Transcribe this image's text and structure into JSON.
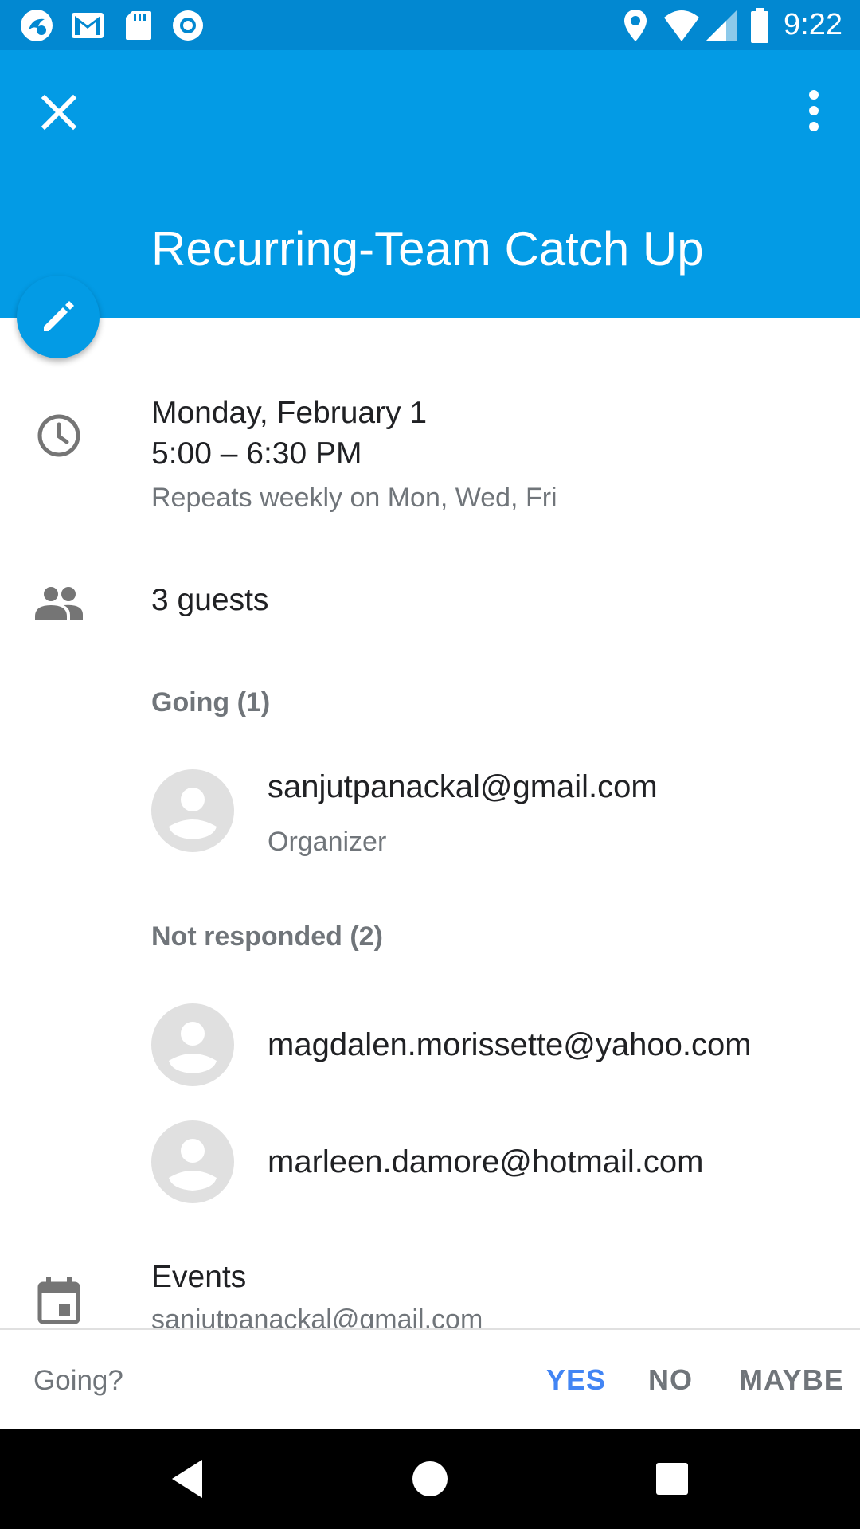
{
  "status_bar": {
    "time": "9:22",
    "left_icons": [
      "app-notification-icon",
      "gmail-icon",
      "sd-card-icon",
      "record-icon"
    ],
    "right_icons": [
      "location-icon",
      "wifi-icon",
      "cell-signal-icon",
      "battery-icon"
    ]
  },
  "app_bar": {
    "close_icon": "close-icon",
    "more_icon": "more-vert-icon",
    "title": "Recurring-Team Catch Up",
    "color": "#039be5"
  },
  "fab": {
    "icon": "edit-pencil-icon"
  },
  "event": {
    "date": "Monday, February 1",
    "time_range": "5:00 – 6:30 PM",
    "recurrence": "Repeats weekly on Mon, Wed, Fri"
  },
  "guests": {
    "summary": "3 guests",
    "groups": [
      {
        "header": "Going (1)",
        "people": [
          {
            "email": "sanjutpanackal@gmail.com",
            "role": "Organizer"
          }
        ]
      },
      {
        "header": "Not responded (2)",
        "people": [
          {
            "email": "magdalen.morissette@yahoo.com"
          },
          {
            "email": "marleen.damore@hotmail.com"
          }
        ]
      }
    ]
  },
  "calendar": {
    "name": "Events",
    "account": "sanjutpanackal@gmail.com"
  },
  "response": {
    "prompt": "Going?",
    "yes": "YES",
    "no": "NO",
    "maybe": "MAYBE",
    "selected": "YES",
    "accent": "#4285f4"
  },
  "nav_bar": {
    "icons": [
      "back-icon",
      "home-icon",
      "recents-icon"
    ]
  }
}
